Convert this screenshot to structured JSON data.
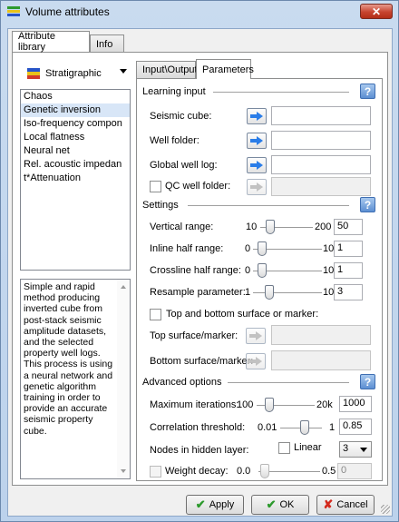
{
  "window": {
    "title": "Volume attributes",
    "close_label": "✕"
  },
  "top_tabs": [
    {
      "label": "Attribute library"
    },
    {
      "label": "Info"
    }
  ],
  "stratigraphic": {
    "label": "Stratigraphic"
  },
  "attributes": [
    {
      "label": "Chaos"
    },
    {
      "label": "Genetic inversion"
    },
    {
      "label": "Iso-frequency compon"
    },
    {
      "label": "Local flatness"
    },
    {
      "label": "Neural net"
    },
    {
      "label": "Rel. acoustic impedan"
    },
    {
      "label": "t*Attenuation"
    }
  ],
  "description": "Simple and rapid method producing inverted cube from post-stack seismic amplitude datasets, and the selected property well logs. This process is using a neural network and genetic algorithm training in order to provide an accurate seismic property cube.",
  "inner_tabs": [
    {
      "label": "Input\\Output"
    },
    {
      "label": "Parameters"
    }
  ],
  "learning_input": {
    "title": "Learning input",
    "help_label": "?",
    "seismic_cube": {
      "label": "Seismic cube:",
      "value": ""
    },
    "well_folder": {
      "label": "Well folder:",
      "value": ""
    },
    "global_well_log": {
      "label": "Global well log:",
      "value": ""
    },
    "qc_well_folder": {
      "label": "QC well folder:",
      "value": ""
    }
  },
  "settings": {
    "title": "Settings",
    "help_label": "?",
    "vertical_range": {
      "label": "Vertical range:",
      "min": "10",
      "max": "200",
      "value": "50"
    },
    "inline_half_range": {
      "label": "Inline half range:",
      "min": "0",
      "max": "10",
      "value": "1"
    },
    "crossline_half_range": {
      "label": "Crossline half range:",
      "min": "0",
      "max": "10",
      "value": "1"
    },
    "resample_parameter": {
      "label": "Resample parameter:",
      "min": "1",
      "max": "10",
      "value": "3"
    },
    "top_bottom": {
      "label": "Top and bottom surface or marker:"
    },
    "top_surface": {
      "label": "Top surface/marker:",
      "value": ""
    },
    "bottom_surface": {
      "label": "Bottom surface/marker:",
      "value": ""
    }
  },
  "advanced": {
    "title": "Advanced options",
    "help_label": "?",
    "max_iterations": {
      "label": "Maximum iterations:",
      "min": "100",
      "max": "20k",
      "value": "1000"
    },
    "correlation_threshold": {
      "label": "Correlation threshold:",
      "min": "0.01",
      "max": "1",
      "value": "0.85"
    },
    "nodes_hidden": {
      "label": "Nodes in hidden layer:",
      "linear_label": "Linear",
      "value": "3"
    },
    "weight_decay": {
      "label": "Weight decay:",
      "min": "0.0",
      "max": "0.5",
      "value": "0"
    }
  },
  "buttons": {
    "apply": "Apply",
    "ok": "OK",
    "cancel": "Cancel"
  }
}
